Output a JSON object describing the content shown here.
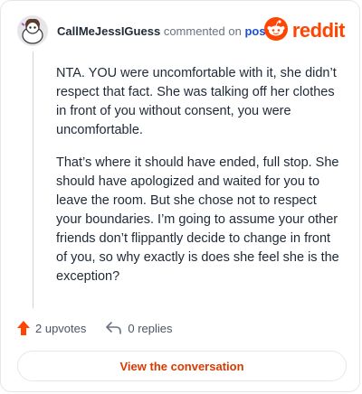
{
  "comment": {
    "author": "CallMeJessIGuess",
    "action": "commented on",
    "target": "post",
    "paragraphs": [
      "NTA. YOU were uncomfortable with it, she didn’t respect that fact. She was talking off her clothes in front of you without consent, you were uncomfortable.",
      "That’s where it should have ended, full stop. She should have apologized and waited for you to leave the room. But she chose not to respect your boundaries. I’m going to assume your other friends don’t flippantly decide to change in front of you, so why exactly is does she feel she is the exception?"
    ],
    "upvotes": "2 upvotes",
    "replies": "0 replies"
  },
  "brand": {
    "wordmark": "reddit",
    "color": "#ff4500"
  },
  "cta": {
    "label": "View the conversation"
  },
  "icons": {
    "logo": "reddit-snoo-icon",
    "upvote": "upvote-arrow-icon",
    "reply": "reply-arrow-icon"
  }
}
